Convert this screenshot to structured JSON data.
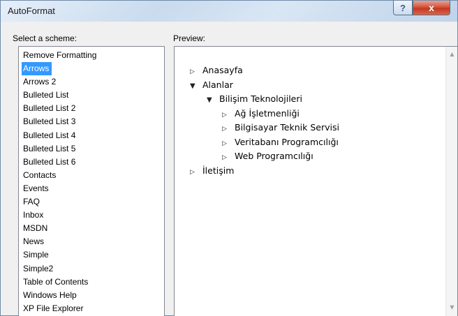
{
  "window": {
    "title": "AutoFormat",
    "help_label": "?",
    "close_label": "x"
  },
  "scheme": {
    "label": "Select a scheme:",
    "selected": "Arrows",
    "items": [
      "Remove Formatting",
      "Arrows",
      "Arrows 2",
      "Bulleted List",
      "Bulleted List 2",
      "Bulleted List 3",
      "Bulleted List 4",
      "Bulleted List 5",
      "Bulleted List 6",
      "Contacts",
      "Events",
      "FAQ",
      "Inbox",
      "MSDN",
      "News",
      "Simple",
      "Simple2",
      "Table of Contents",
      "Windows Help",
      "XP File Explorer"
    ]
  },
  "preview": {
    "label": "Preview:",
    "tree": [
      {
        "text": "Anasayfa",
        "level": 0,
        "expanded": false
      },
      {
        "text": "Alanlar",
        "level": 0,
        "expanded": true
      },
      {
        "text": "Bilişim Teknolojileri",
        "level": 1,
        "expanded": true
      },
      {
        "text": "Ağ İşletmenliği",
        "level": 2,
        "expanded": false
      },
      {
        "text": "Bilgisayar Teknik Servisi",
        "level": 2,
        "expanded": false
      },
      {
        "text": "Veritabanı Programcılığı",
        "level": 2,
        "expanded": false
      },
      {
        "text": "Web Programcılığı",
        "level": 2,
        "expanded": false
      },
      {
        "text": "İletişim",
        "level": 0,
        "expanded": false
      }
    ]
  },
  "icons": {
    "collapsed": "triangle-right-icon",
    "expanded": "triangle-down-icon"
  }
}
